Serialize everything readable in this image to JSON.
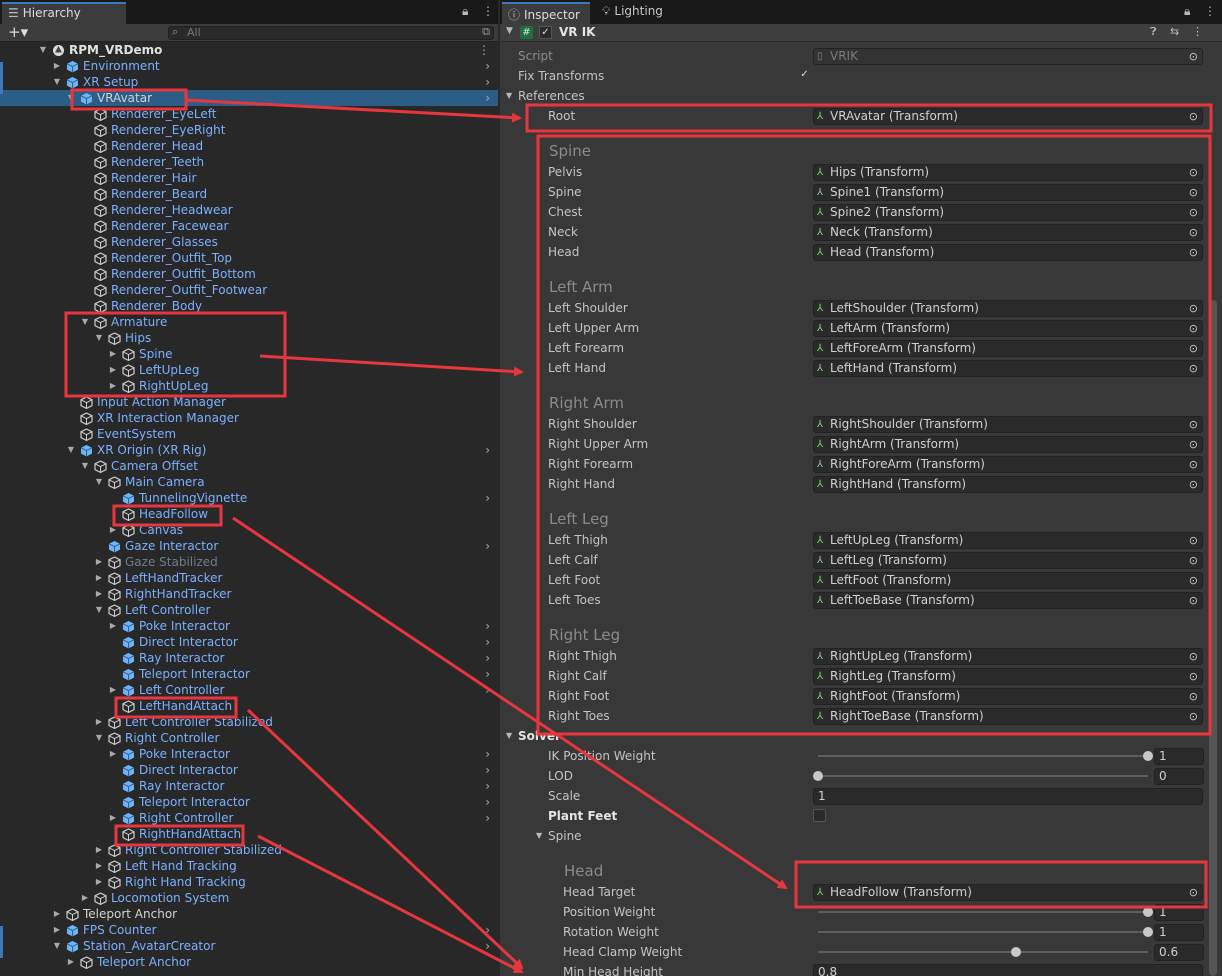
{
  "hierarchy": {
    "tab_label": "Hierarchy",
    "search_placeholder": "All",
    "rows": [
      {
        "label": "RPM_VRDemo",
        "indent": 0,
        "fold": "open",
        "style": "bold",
        "icon": "unity-scene-icon",
        "more": true
      },
      {
        "label": "Environment",
        "indent": 1,
        "fold": "closed",
        "style": "blue",
        "icon": "prefab-cube-icon",
        "chev": true
      },
      {
        "label": "XR Setup",
        "indent": 1,
        "fold": "open",
        "style": "blue",
        "icon": "prefab-cube-icon",
        "chev": true
      },
      {
        "label": "VRAvatar",
        "indent": 2,
        "fold": "open",
        "style": "white",
        "icon": "prefab-cube-icon",
        "selected": true,
        "chev": true
      },
      {
        "label": "Renderer_EyeLeft",
        "indent": 3,
        "style": "blue",
        "icon": "gameobject-cube-icon"
      },
      {
        "label": "Renderer_EyeRight",
        "indent": 3,
        "style": "blue",
        "icon": "gameobject-cube-icon"
      },
      {
        "label": "Renderer_Head",
        "indent": 3,
        "style": "blue",
        "icon": "gameobject-cube-icon"
      },
      {
        "label": "Renderer_Teeth",
        "indent": 3,
        "style": "blue",
        "icon": "gameobject-cube-icon"
      },
      {
        "label": "Renderer_Hair",
        "indent": 3,
        "style": "blue",
        "icon": "gameobject-cube-icon"
      },
      {
        "label": "Renderer_Beard",
        "indent": 3,
        "style": "blue",
        "icon": "gameobject-cube-icon"
      },
      {
        "label": "Renderer_Headwear",
        "indent": 3,
        "style": "blue",
        "icon": "gameobject-cube-icon"
      },
      {
        "label": "Renderer_Facewear",
        "indent": 3,
        "style": "blue",
        "icon": "gameobject-cube-icon"
      },
      {
        "label": "Renderer_Glasses",
        "indent": 3,
        "style": "blue",
        "icon": "gameobject-cube-icon"
      },
      {
        "label": "Renderer_Outfit_Top",
        "indent": 3,
        "style": "blue",
        "icon": "gameobject-cube-icon"
      },
      {
        "label": "Renderer_Outfit_Bottom",
        "indent": 3,
        "style": "blue",
        "icon": "gameobject-cube-icon"
      },
      {
        "label": "Renderer_Outfit_Footwear",
        "indent": 3,
        "style": "blue",
        "icon": "gameobject-cube-icon"
      },
      {
        "label": "Renderer_Body",
        "indent": 3,
        "style": "blue",
        "icon": "gameobject-cube-icon"
      },
      {
        "label": "Armature",
        "indent": 3,
        "fold": "open",
        "style": "blue",
        "icon": "gameobject-cube-icon"
      },
      {
        "label": "Hips",
        "indent": 4,
        "fold": "open",
        "style": "blue",
        "icon": "gameobject-cube-icon"
      },
      {
        "label": "Spine",
        "indent": 5,
        "fold": "closed",
        "style": "blue",
        "icon": "gameobject-cube-icon"
      },
      {
        "label": "LeftUpLeg",
        "indent": 5,
        "fold": "closed",
        "style": "blue",
        "icon": "gameobject-cube-icon"
      },
      {
        "label": "RightUpLeg",
        "indent": 5,
        "fold": "closed",
        "style": "blue",
        "icon": "gameobject-cube-icon"
      },
      {
        "label": "Input Action Manager",
        "indent": 2,
        "style": "blue",
        "icon": "gameobject-cube-icon"
      },
      {
        "label": "XR Interaction Manager",
        "indent": 2,
        "style": "blue",
        "icon": "gameobject-cube-icon"
      },
      {
        "label": "EventSystem",
        "indent": 2,
        "style": "blue",
        "icon": "gameobject-cube-icon"
      },
      {
        "label": "XR Origin (XR Rig)",
        "indent": 2,
        "fold": "open",
        "style": "blue",
        "icon": "prefab-cube-icon",
        "chev": true
      },
      {
        "label": "Camera Offset",
        "indent": 3,
        "fold": "open",
        "style": "blue",
        "icon": "gameobject-cube-icon"
      },
      {
        "label": "Main Camera",
        "indent": 4,
        "fold": "open",
        "style": "blue",
        "icon": "gameobject-cube-icon"
      },
      {
        "label": "TunnelingVignette",
        "indent": 5,
        "style": "blue",
        "icon": "prefab-cube-icon",
        "chev": true
      },
      {
        "label": "HeadFollow",
        "indent": 5,
        "style": "blue",
        "icon": "gameobject-cube-icon"
      },
      {
        "label": "Canvas",
        "indent": 5,
        "fold": "closed",
        "style": "blue",
        "icon": "gameobject-cube-icon"
      },
      {
        "label": "Gaze Interactor",
        "indent": 4,
        "style": "blue",
        "icon": "prefab-cube-icon",
        "chev": true
      },
      {
        "label": "Gaze Stabilized",
        "indent": 4,
        "fold": "closed",
        "style": "gray",
        "icon": "gameobject-cube-icon"
      },
      {
        "label": "LeftHandTracker",
        "indent": 4,
        "fold": "closed",
        "style": "blue",
        "icon": "gameobject-cube-icon"
      },
      {
        "label": "RightHandTracker",
        "indent": 4,
        "fold": "closed",
        "style": "blue",
        "icon": "gameobject-cube-icon"
      },
      {
        "label": "Left Controller",
        "indent": 4,
        "fold": "open",
        "style": "blue",
        "icon": "gameobject-cube-icon"
      },
      {
        "label": "Poke Interactor",
        "indent": 5,
        "fold": "closed",
        "style": "blue",
        "icon": "prefab-cube-icon",
        "chev": true
      },
      {
        "label": "Direct Interactor",
        "indent": 5,
        "style": "blue",
        "icon": "prefab-cube-icon",
        "chev": true
      },
      {
        "label": "Ray Interactor",
        "indent": 5,
        "style": "blue",
        "icon": "prefab-cube-icon",
        "chev": true
      },
      {
        "label": "Teleport Interactor",
        "indent": 5,
        "style": "blue",
        "icon": "prefab-cube-icon",
        "chev": true
      },
      {
        "label": "Left Controller",
        "indent": 5,
        "fold": "closed",
        "style": "blue",
        "icon": "prefab-cube-icon",
        "chev": true
      },
      {
        "label": "LeftHandAttach",
        "indent": 5,
        "style": "blue",
        "icon": "gameobject-cube-icon"
      },
      {
        "label": "Left Controller Stabilized",
        "indent": 4,
        "fold": "closed",
        "style": "blue",
        "icon": "gameobject-cube-icon"
      },
      {
        "label": "Right Controller",
        "indent": 4,
        "fold": "open",
        "style": "blue",
        "icon": "gameobject-cube-icon"
      },
      {
        "label": "Poke Interactor",
        "indent": 5,
        "fold": "closed",
        "style": "blue",
        "icon": "prefab-cube-icon",
        "chev": true
      },
      {
        "label": "Direct Interactor",
        "indent": 5,
        "style": "blue",
        "icon": "prefab-cube-icon",
        "chev": true
      },
      {
        "label": "Ray Interactor",
        "indent": 5,
        "style": "blue",
        "icon": "prefab-cube-icon",
        "chev": true
      },
      {
        "label": "Teleport Interactor",
        "indent": 5,
        "style": "blue",
        "icon": "prefab-cube-icon",
        "chev": true
      },
      {
        "label": "Right Controller",
        "indent": 5,
        "fold": "closed",
        "style": "blue",
        "icon": "prefab-cube-icon",
        "chev": true
      },
      {
        "label": "RightHandAttach",
        "indent": 5,
        "style": "blue",
        "icon": "gameobject-cube-icon"
      },
      {
        "label": "Right Controller Stabilized",
        "indent": 4,
        "fold": "closed",
        "style": "blue",
        "icon": "gameobject-cube-icon"
      },
      {
        "label": "Left Hand Tracking",
        "indent": 4,
        "fold": "closed",
        "style": "blue",
        "icon": "gameobject-cube-icon"
      },
      {
        "label": "Right Hand Tracking",
        "indent": 4,
        "fold": "closed",
        "style": "blue",
        "icon": "gameobject-cube-icon"
      },
      {
        "label": "Locomotion System",
        "indent": 3,
        "fold": "closed",
        "style": "blue",
        "icon": "gameobject-cube-icon"
      },
      {
        "label": "Teleport Anchor",
        "indent": 1,
        "fold": "closed",
        "style": "white",
        "icon": "gameobject-cube-icon"
      },
      {
        "label": "FPS Counter",
        "indent": 1,
        "fold": "closed",
        "style": "blue",
        "icon": "prefab-cube-icon",
        "chev": true
      },
      {
        "label": "Station_AvatarCreator",
        "indent": 1,
        "fold": "open",
        "style": "blue",
        "icon": "prefab-cube-icon",
        "chev": true
      },
      {
        "label": "Teleport Anchor",
        "indent": 2,
        "fold": "closed",
        "style": "blue",
        "icon": "gameobject-cube-icon"
      }
    ]
  },
  "inspector": {
    "tabs": [
      "Inspector",
      "Lighting"
    ],
    "component_title": "VR IK",
    "component_enabled": true,
    "script_label": "Script",
    "script_value": "VRIK",
    "fix_transforms_label": "Fix Transforms",
    "fix_transforms_checked": true,
    "references_label": "References",
    "root_label": "Root",
    "root_value": "VRAvatar (Transform)",
    "groups": [
      {
        "title": "Spine",
        "rows": [
          {
            "label": "Pelvis",
            "value": "Hips (Transform)"
          },
          {
            "label": "Spine",
            "value": "Spine1 (Transform)"
          },
          {
            "label": "Chest",
            "value": "Spine2 (Transform)"
          },
          {
            "label": "Neck",
            "value": "Neck (Transform)"
          },
          {
            "label": "Head",
            "value": "Head (Transform)"
          }
        ]
      },
      {
        "title": "Left Arm",
        "rows": [
          {
            "label": "Left Shoulder",
            "value": "LeftShoulder (Transform)"
          },
          {
            "label": "Left Upper Arm",
            "value": "LeftArm (Transform)"
          },
          {
            "label": "Left Forearm",
            "value": "LeftForeArm (Transform)"
          },
          {
            "label": "Left Hand",
            "value": "LeftHand (Transform)"
          }
        ]
      },
      {
        "title": "Right Arm",
        "rows": [
          {
            "label": "Right Shoulder",
            "value": "RightShoulder (Transform)"
          },
          {
            "label": "Right Upper Arm",
            "value": "RightArm (Transform)"
          },
          {
            "label": "Right Forearm",
            "value": "RightForeArm (Transform)"
          },
          {
            "label": "Right Hand",
            "value": "RightHand (Transform)"
          }
        ]
      },
      {
        "title": "Left Leg",
        "rows": [
          {
            "label": "Left Thigh",
            "value": "LeftUpLeg (Transform)"
          },
          {
            "label": "Left Calf",
            "value": "LeftLeg (Transform)"
          },
          {
            "label": "Left Foot",
            "value": "LeftFoot (Transform)"
          },
          {
            "label": "Left Toes",
            "value": "LeftToeBase (Transform)"
          }
        ]
      },
      {
        "title": "Right Leg",
        "rows": [
          {
            "label": "Right Thigh",
            "value": "RightUpLeg (Transform)"
          },
          {
            "label": "Right Calf",
            "value": "RightLeg (Transform)"
          },
          {
            "label": "Right Foot",
            "value": "RightFoot (Transform)"
          },
          {
            "label": "Right Toes",
            "value": "RightToeBase (Transform)"
          }
        ]
      }
    ],
    "solver": {
      "label": "Solver",
      "ik_position_weight_label": "IK Position Weight",
      "ik_position_weight": "1",
      "lod_label": "LOD",
      "lod": "0",
      "scale_label": "Scale",
      "scale": "1",
      "plant_feet_label": "Plant Feet",
      "spine_label": "Spine",
      "head_title": "Head",
      "head_target_label": "Head Target",
      "head_target_value": "HeadFollow (Transform)",
      "position_weight_label": "Position Weight",
      "position_weight": "1",
      "rotation_weight_label": "Rotation Weight",
      "rotation_weight": "1",
      "head_clamp_weight_label": "Head Clamp Weight",
      "head_clamp_weight": "0.6",
      "min_head_height_label": "Min Head Height",
      "min_head_height": "0.8"
    }
  },
  "colors": {
    "annotation": "#e8363e",
    "selection": "#2c5d87",
    "prefab_text": "#7bb0ff"
  }
}
